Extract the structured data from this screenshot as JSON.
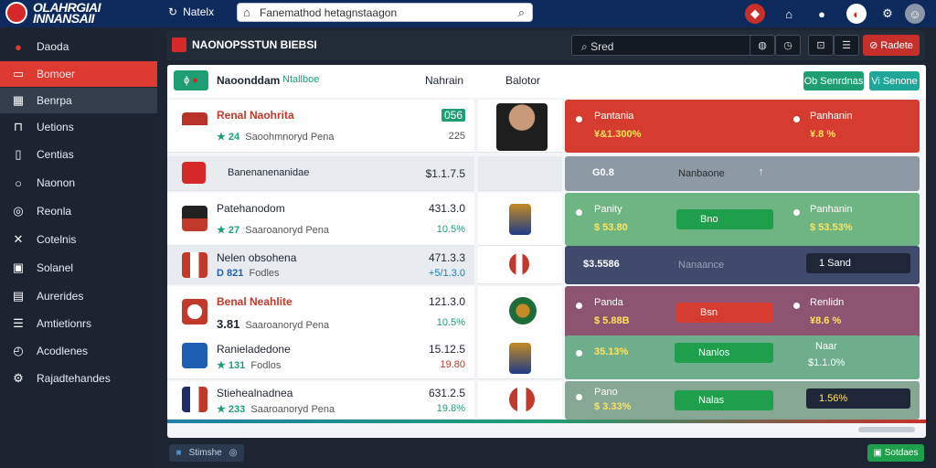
{
  "topbar": {
    "logo_text": "OLAHRGIAI INNANSAII",
    "nav_label": "Natelx",
    "search_value": "Fanemathod hetagnstaagon"
  },
  "sidebar": {
    "items": [
      {
        "label": "Daoda"
      },
      {
        "label": "Bomoer"
      },
      {
        "label": "Benrpa"
      },
      {
        "label": "Uetions"
      },
      {
        "label": "Centias"
      },
      {
        "label": "Naonon"
      },
      {
        "label": "Reonla"
      },
      {
        "label": "Cotelnis"
      },
      {
        "label": "Solanel"
      },
      {
        "label": "Aurerides"
      },
      {
        "label": "Amtietionrs"
      },
      {
        "label": "Acodlenes"
      },
      {
        "label": "Rajadtehandes"
      }
    ]
  },
  "panel": {
    "title": "NAONOPSSTUN BIEBSI",
    "select_value": "Sred",
    "action_label": "Radete"
  },
  "card": {
    "tag_label": "ɸ",
    "title": "Naoonddam",
    "subtitle": "Ntallboe",
    "col_a": "Nahrain",
    "col_b": "Balotor",
    "btn1": "Ob Senrdnas",
    "btn2": "Vi Senone",
    "rows": [
      {
        "name": "Renal Naohrita",
        "sub": "Saoohmnoryd Pena",
        "star": "★ 24",
        "val": "056",
        "val2": "225",
        "right": {
          "l1": "Pantania",
          "v1": "¥&1.300%",
          "l2": "Panhanin",
          "v2": "¥.8 %"
        }
      },
      {
        "name": "Banenanenanidae",
        "sub": "",
        "star": "",
        "val": "$1.1.7.5",
        "val2": "",
        "right": {
          "l1": "G0.8",
          "v1": "",
          "l2": "Nanbaone",
          "v2": ""
        }
      },
      {
        "name": "Patehanodom",
        "sub": "Saaroanoryd Pena",
        "star": "★ 27",
        "val": "431.3.0",
        "val2": "10.5%",
        "right": {
          "l1": "Panity",
          "v1": "$ 53.80",
          "pill": "Bno",
          "l2": "Panhanin",
          "v2": "$ 53.53%"
        }
      },
      {
        "name": "Nelen obsohena",
        "sub": "Fodles",
        "star": "D 821",
        "val": "471.3.3",
        "val2": "+5/1.3.0",
        "right": {
          "l1": "$3.5586",
          "v1": "",
          "l2": "Nanaance",
          "v2": "1 Sand"
        }
      },
      {
        "name": "Benal Neahlite",
        "sub": "Saaroanoryd Pena",
        "star": "3.81",
        "val": "121.3.0",
        "val2": "10.5%",
        "right": {
          "l1": "Panda",
          "v1": "$ 5.88B",
          "pill": "Bsn",
          "l2": "Renlidn",
          "v2": "¥8.6 %"
        }
      },
      {
        "name": "Ranieladedone",
        "sub": "Fodlos",
        "star": "★ 131",
        "val": "15.12.5",
        "val2": "19.80",
        "right": {
          "l1": "",
          "v1": "35.13%",
          "pill": "Nanlos",
          "l2": "Naar",
          "v2": "$1.1.0%"
        }
      },
      {
        "name": "Stiehealnadnea",
        "sub": "Saaroanoryd Pena",
        "star": "★ 233",
        "val": "631.2.5",
        "val2": "19.8%",
        "right": {
          "l1": "Pano",
          "v1": "$ 3.33%",
          "pill": "Nalas",
          "l2": "",
          "v2": "1.56%"
        }
      }
    ]
  },
  "footer": {
    "left_label": "Stimshe",
    "right_label": "Sotdaes"
  },
  "colors": {
    "brand_navy": "#0e2a5c",
    "accent_red": "#dd3a31",
    "accent_green": "#1f9e73"
  }
}
